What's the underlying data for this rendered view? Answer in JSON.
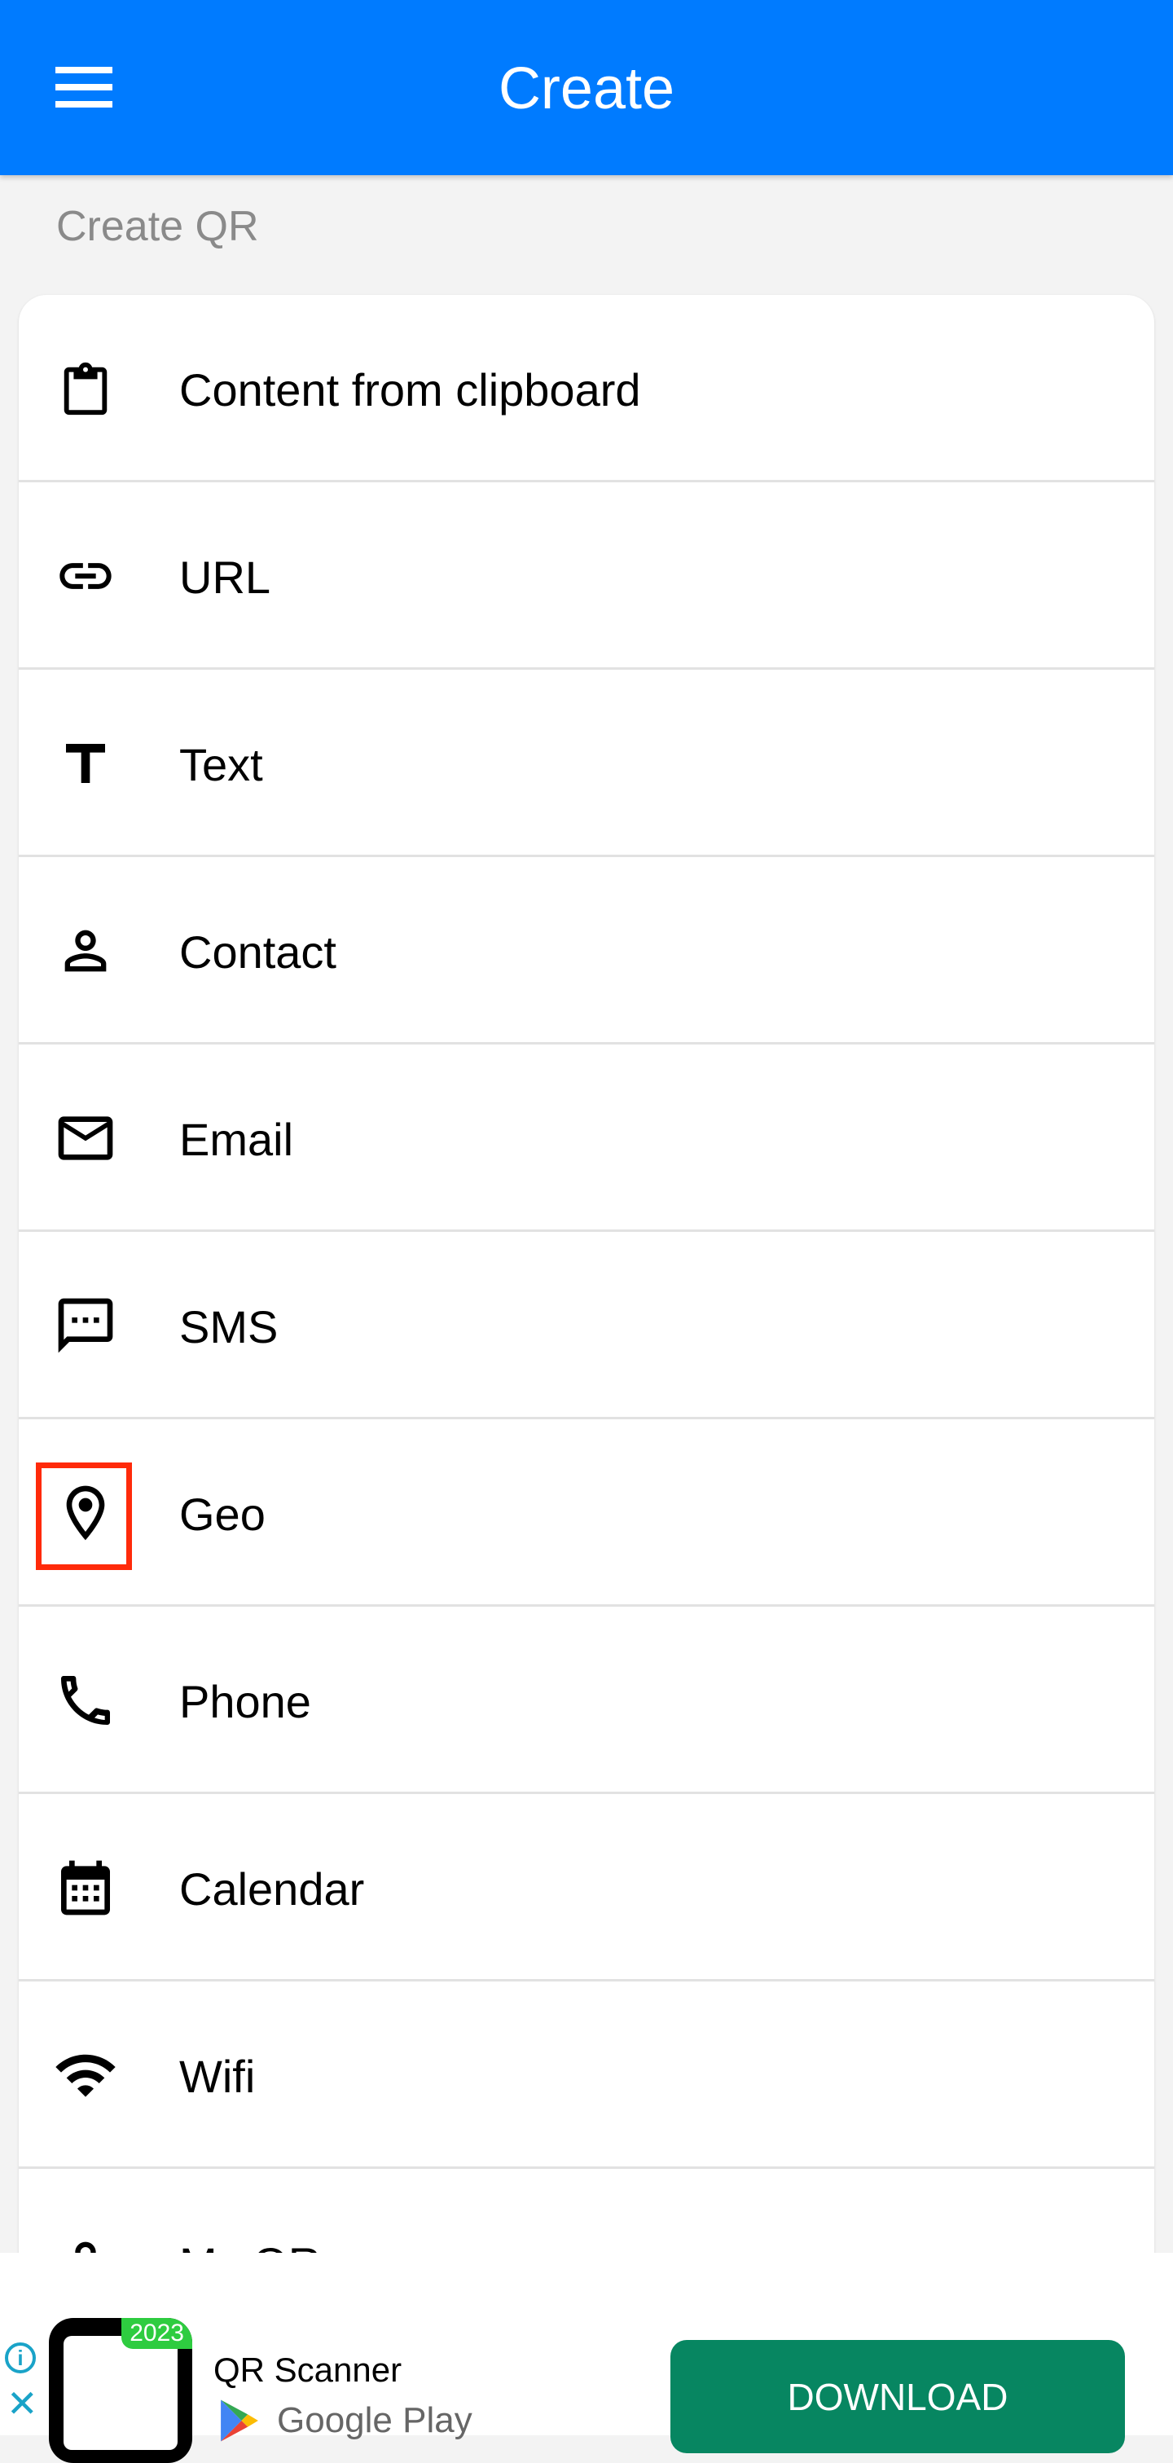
{
  "header": {
    "title": "Create"
  },
  "section_label": "Create QR",
  "items": [
    {
      "label": "Content from clipboard",
      "icon": "clipboard-icon"
    },
    {
      "label": "URL",
      "icon": "link-icon"
    },
    {
      "label": "Text",
      "icon": "text-icon"
    },
    {
      "label": "Contact",
      "icon": "person-icon"
    },
    {
      "label": "Email",
      "icon": "email-icon"
    },
    {
      "label": "SMS",
      "icon": "sms-icon"
    },
    {
      "label": "Geo",
      "icon": "location-pin-icon"
    },
    {
      "label": "Phone",
      "icon": "phone-icon"
    },
    {
      "label": "Calendar",
      "icon": "calendar-icon"
    },
    {
      "label": "Wifi",
      "icon": "wifi-icon"
    },
    {
      "label": "My QR",
      "icon": "person-icon"
    }
  ],
  "ad": {
    "app_name": "QR Scanner",
    "badge": "2023",
    "store": "Google Play",
    "button": "DOWNLOAD"
  },
  "colors": {
    "header": "#007bff",
    "download": "#078661",
    "highlight": "#ff2a0a"
  }
}
